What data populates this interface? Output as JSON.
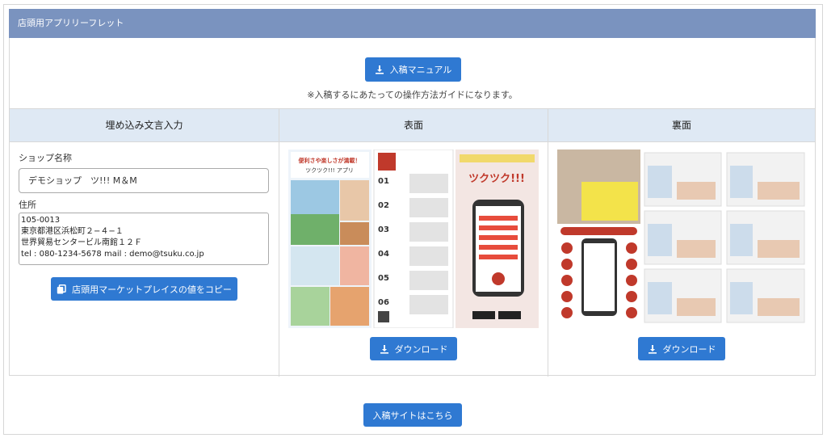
{
  "header": {
    "title": "店頭用アプリリーフレット"
  },
  "manual": {
    "button_label": "入稿マニュアル",
    "note": "※入稿するにあたっての操作方法ガイドになります。"
  },
  "columns": {
    "embed_title": "埋め込み文言入力",
    "front_title": "表面",
    "back_title": "裏面"
  },
  "form": {
    "shop_label": "ショップ名称",
    "shop_value": "デモショップ　ツ!!! M＆M",
    "address_label": "住所",
    "address_value": "105-0013\n東京都港区浜松町２−４−１\n世界貿易センタービル南館１２Ｆ\ntel : 080-1234-5678 mail : demo@tsuku.co.jp",
    "copy_button": "店頭用マーケットプレイスの値をコピー"
  },
  "front": {
    "headline": "便利さや楽しさが満載！ツクツク!!! アプリ",
    "brand": "ツクツク!!!",
    "download_label": "ダウンロード"
  },
  "back": {
    "download_label": "ダウンロード"
  },
  "footer": {
    "site_button": "入稿サイトはこちら"
  },
  "colors": {
    "header": "#7a93bf",
    "button": "#2f79d2",
    "column_head": "#dfe9f4"
  },
  "icons": {
    "download": "download-icon",
    "copy": "copy-icon"
  }
}
